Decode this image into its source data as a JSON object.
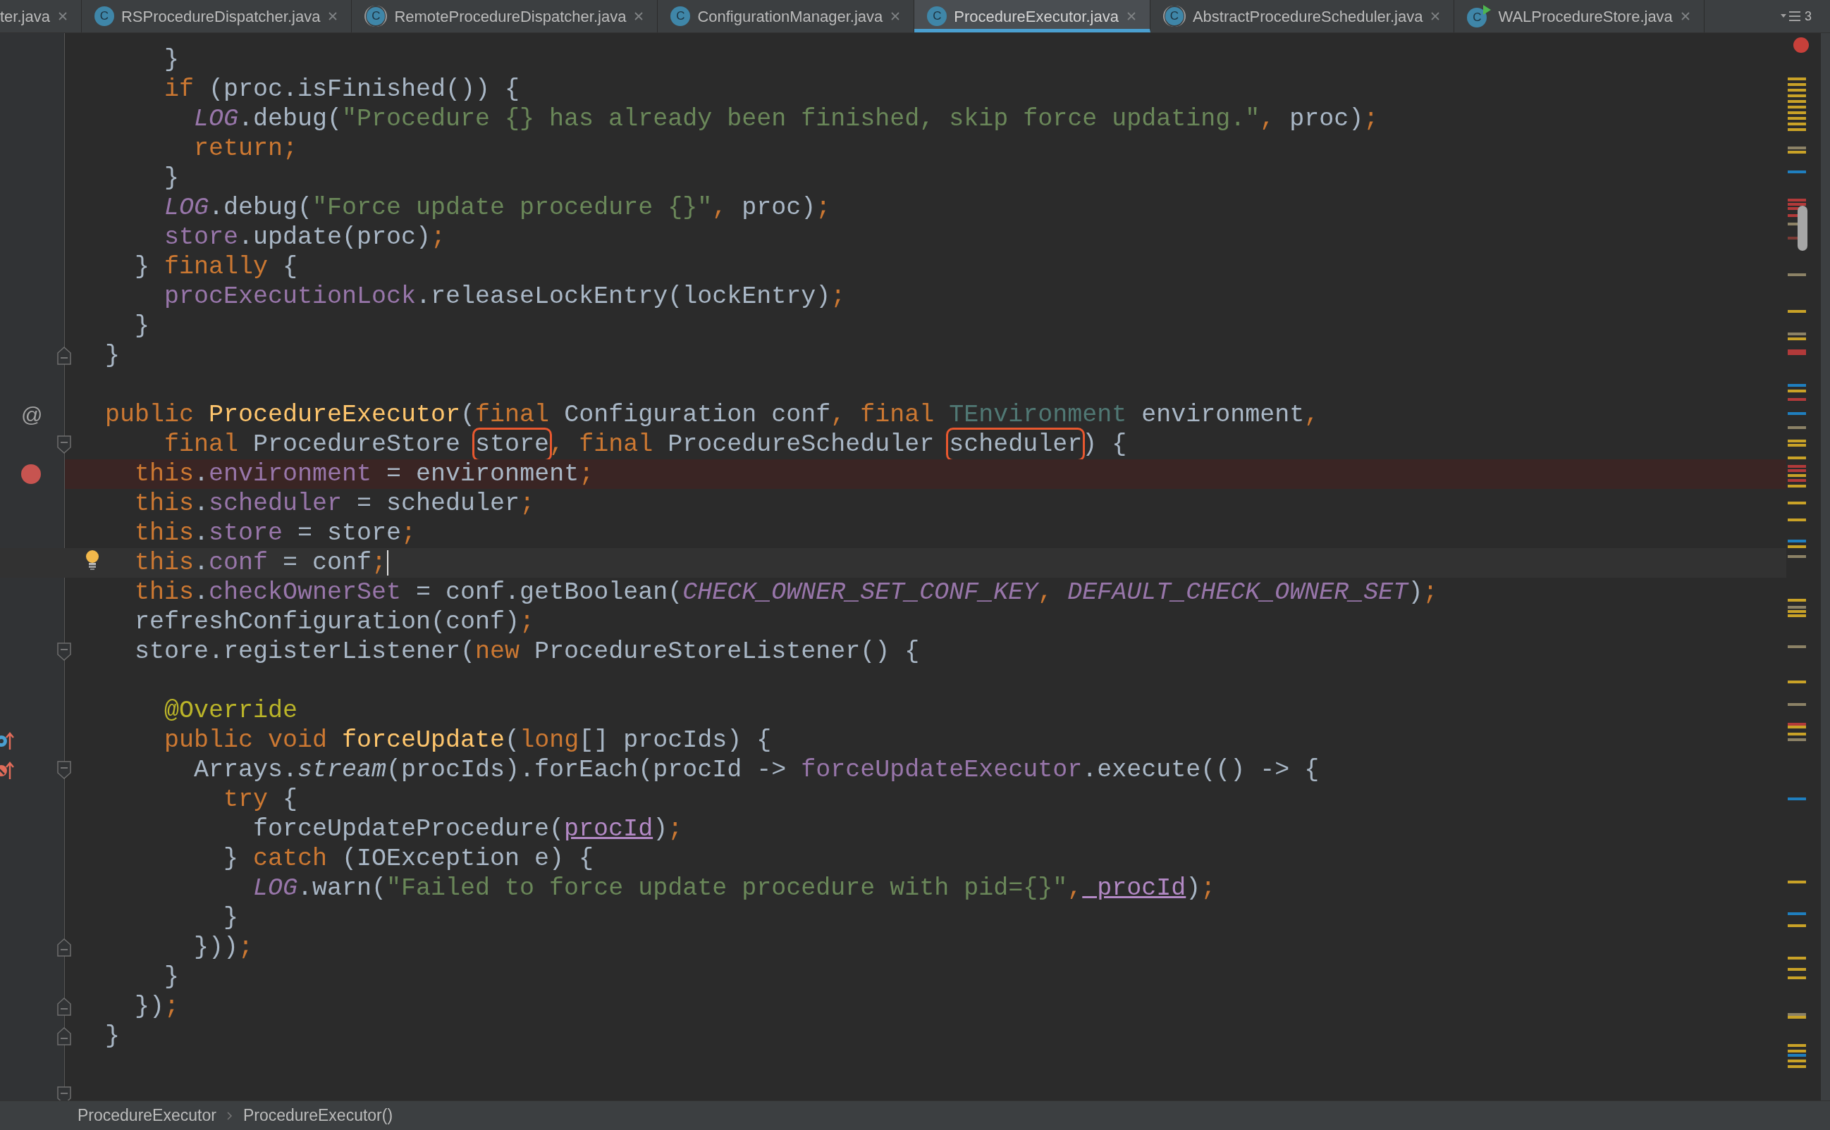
{
  "tabs": [
    {
      "label": "ter.java",
      "selected": false,
      "kind": "file"
    },
    {
      "label": "RSProcedureDispatcher.java",
      "selected": false,
      "kind": "class",
      "icon_letter": "C"
    },
    {
      "label": "RemoteProcedureDispatcher.java",
      "selected": false,
      "kind": "abstract-class",
      "icon_letter": "C"
    },
    {
      "label": "ConfigurationManager.java",
      "selected": false,
      "kind": "class",
      "icon_letter": "C"
    },
    {
      "label": "ProcedureExecutor.java",
      "selected": true,
      "kind": "class",
      "icon_letter": "C"
    },
    {
      "label": "AbstractProcedureScheduler.java",
      "selected": false,
      "kind": "abstract-class",
      "icon_letter": "C"
    },
    {
      "label": "WALProcedureStore.java",
      "selected": false,
      "kind": "runnable-class",
      "icon_letter": "C"
    }
  ],
  "hidden_tab_count": "3",
  "editor": {
    "lines": [
      {
        "breakpoint": false,
        "current": false
      },
      {
        "breakpoint": false,
        "current": false,
        "tokens": [
          {
            "text": "    }",
            "kind": "plain"
          }
        ]
      },
      {
        "breakpoint": false,
        "current": false,
        "tokens": [
          {
            "text": "    if",
            "kind": "keyword"
          },
          {
            "text": " (proc.isFinished()) {",
            "kind": "plain"
          }
        ]
      },
      {
        "breakpoint": false,
        "current": false,
        "tokens": [
          {
            "text": "      LOG",
            "kind": "static-field"
          },
          {
            "text": ".debug(",
            "kind": "plain"
          },
          {
            "text": "\"Procedure {} has already been finished, skip force updating.\"",
            "kind": "string"
          },
          {
            "text": ",",
            "kind": "keyword"
          },
          {
            "text": " proc)",
            "kind": "plain"
          },
          {
            "text": ";",
            "kind": "keyword"
          }
        ]
      },
      {
        "breakpoint": false,
        "current": false,
        "tokens": [
          {
            "text": "      return;",
            "kind": "keyword"
          }
        ]
      },
      {
        "breakpoint": false,
        "current": false,
        "tokens": [
          {
            "text": "    }",
            "kind": "plain"
          }
        ]
      },
      {
        "breakpoint": false,
        "current": false,
        "tokens": [
          {
            "text": "    LOG",
            "kind": "static-field"
          },
          {
            "text": ".debug(",
            "kind": "plain"
          },
          {
            "text": "\"Force update procedure {}\"",
            "kind": "string"
          },
          {
            "text": ",",
            "kind": "keyword"
          },
          {
            "text": " proc)",
            "kind": "plain"
          },
          {
            "text": ";",
            "kind": "keyword"
          }
        ]
      },
      {
        "breakpoint": false,
        "current": false,
        "tokens": [
          {
            "text": "    store",
            "kind": "field"
          },
          {
            "text": ".update(proc)",
            "kind": "plain"
          },
          {
            "text": ";",
            "kind": "keyword"
          }
        ]
      },
      {
        "breakpoint": false,
        "current": false,
        "tokens": [
          {
            "text": "  }",
            "kind": "plain"
          },
          {
            "text": " finally",
            "kind": "keyword"
          },
          {
            "text": " {",
            "kind": "plain"
          }
        ]
      },
      {
        "breakpoint": false,
        "current": false,
        "tokens": [
          {
            "text": "    procExecutionLock",
            "kind": "field"
          },
          {
            "text": ".releaseLockEntry(lockEntry)",
            "kind": "plain"
          },
          {
            "text": ";",
            "kind": "keyword"
          }
        ]
      },
      {
        "breakpoint": false,
        "current": false,
        "tokens": [
          {
            "text": "  }",
            "kind": "plain"
          }
        ]
      },
      {
        "breakpoint": false,
        "current": false,
        "fold": {
          "kind": "end"
        },
        "tokens": [
          {
            "text": "}",
            "kind": "plain"
          }
        ]
      },
      {
        "breakpoint": false,
        "current": false
      },
      {
        "breakpoint": false,
        "current": false,
        "gutter": {
          "kind": "symbol",
          "text": "@"
        },
        "tokens": [
          {
            "text": "public",
            "kind": "keyword"
          },
          {
            "text": " ProcedureExecutor",
            "kind": "method-declaration"
          },
          {
            "text": "(",
            "kind": "plain"
          },
          {
            "text": "final",
            "kind": "keyword"
          },
          {
            "text": " Configuration conf",
            "kind": "plain"
          },
          {
            "text": ",",
            "kind": "keyword"
          },
          {
            "text": " final",
            "kind": "keyword"
          },
          {
            "text": " TEnvironment",
            "kind": "unused-type"
          },
          {
            "text": " environment",
            "kind": "plain"
          },
          {
            "text": ",",
            "kind": "keyword"
          }
        ]
      },
      {
        "breakpoint": false,
        "current": false,
        "fold": {
          "kind": "start"
        },
        "tokens": [
          {
            "text": "    final",
            "kind": "keyword"
          },
          {
            "text": " ProcedureStore ",
            "kind": "plain"
          },
          {
            "text": "store",
            "kind": "highlighted"
          },
          {
            "text": ",",
            "kind": "keyword"
          },
          {
            "text": " final",
            "kind": "keyword"
          },
          {
            "text": " ProcedureScheduler ",
            "kind": "plain"
          },
          {
            "text": "scheduler",
            "kind": "highlighted"
          },
          {
            "text": ") {",
            "kind": "plain"
          }
        ]
      },
      {
        "breakpoint": true,
        "current": false,
        "tokens": [
          {
            "text": "  this",
            "kind": "keyword"
          },
          {
            "text": ".",
            "kind": "plain"
          },
          {
            "text": "environment",
            "kind": "field"
          },
          {
            "text": " = environment",
            "kind": "plain"
          },
          {
            "text": ";",
            "kind": "keyword"
          }
        ]
      },
      {
        "breakpoint": false,
        "current": false,
        "tokens": [
          {
            "text": "  this",
            "kind": "keyword"
          },
          {
            "text": ".",
            "kind": "plain"
          },
          {
            "text": "scheduler",
            "kind": "field"
          },
          {
            "text": " = scheduler",
            "kind": "plain"
          },
          {
            "text": ";",
            "kind": "keyword"
          }
        ]
      },
      {
        "breakpoint": false,
        "current": false,
        "tokens": [
          {
            "text": "  this",
            "kind": "keyword"
          },
          {
            "text": ".",
            "kind": "plain"
          },
          {
            "text": "store",
            "kind": "field"
          },
          {
            "text": " = store",
            "kind": "plain"
          },
          {
            "text": ";",
            "kind": "keyword"
          }
        ]
      },
      {
        "breakpoint": false,
        "current": true,
        "marker": {
          "kind": "bulb"
        },
        "tokens": [
          {
            "text": "  this",
            "kind": "keyword"
          },
          {
            "text": ".",
            "kind": "plain"
          },
          {
            "text": "conf",
            "kind": "field"
          },
          {
            "text": " = conf",
            "kind": "plain"
          },
          {
            "text": ";",
            "kind": "keyword"
          }
        ]
      },
      {
        "breakpoint": false,
        "current": false,
        "tokens": [
          {
            "text": "  this",
            "kind": "keyword"
          },
          {
            "text": ".",
            "kind": "plain"
          },
          {
            "text": "checkOwnerSet",
            "kind": "field"
          },
          {
            "text": " = conf.getBoolean(",
            "kind": "plain"
          },
          {
            "text": "CHECK_OWNER_SET_CONF_KEY",
            "kind": "static-field"
          },
          {
            "text": ",",
            "kind": "keyword"
          },
          {
            "text": " DEFAULT_CHECK_OWNER_SET",
            "kind": "static-field"
          },
          {
            "text": ")",
            "kind": "plain"
          },
          {
            "text": ";",
            "kind": "keyword"
          }
        ]
      },
      {
        "breakpoint": false,
        "current": false,
        "tokens": [
          {
            "text": "  refreshConfiguration(conf)",
            "kind": "plain"
          },
          {
            "text": ";",
            "kind": "keyword"
          }
        ]
      },
      {
        "breakpoint": false,
        "current": false,
        "fold": {
          "kind": "start"
        },
        "tokens": [
          {
            "text": "  store.registerListener(",
            "kind": "plain"
          },
          {
            "text": "new",
            "kind": "keyword"
          },
          {
            "text": " ProcedureStoreListener() {",
            "kind": "plain"
          }
        ]
      },
      {
        "breakpoint": false,
        "current": false
      },
      {
        "breakpoint": false,
        "current": false,
        "tokens": [
          {
            "text": "    @Override",
            "kind": "annotation"
          }
        ]
      },
      {
        "breakpoint": false,
        "current": false,
        "gutter": {
          "kind": "implements"
        },
        "tokens": [
          {
            "text": "    public void",
            "kind": "keyword"
          },
          {
            "text": " forceUpdate",
            "kind": "method-declaration"
          },
          {
            "text": "(",
            "kind": "plain"
          },
          {
            "text": "long",
            "kind": "keyword"
          },
          {
            "text": "[] procIds) {",
            "kind": "plain"
          }
        ]
      },
      {
        "breakpoint": false,
        "current": false,
        "gutter": {
          "kind": "overrides"
        },
        "fold": {
          "kind": "start"
        },
        "tokens": [
          {
            "text": "      Arrays.",
            "kind": "plain"
          },
          {
            "text": "stream",
            "kind": "static-call"
          },
          {
            "text": "(procIds).forEach(procId -> ",
            "kind": "plain"
          },
          {
            "text": "forceUpdateExecutor",
            "kind": "field"
          },
          {
            "text": ".execute(() -> {",
            "kind": "plain"
          }
        ]
      },
      {
        "breakpoint": false,
        "current": false,
        "tokens": [
          {
            "text": "        try",
            "kind": "keyword"
          },
          {
            "text": " {",
            "kind": "plain"
          }
        ]
      },
      {
        "breakpoint": false,
        "current": false,
        "tokens": [
          {
            "text": "          forceUpdateProcedure(",
            "kind": "plain"
          },
          {
            "text": "procId",
            "kind": "captured-variable"
          },
          {
            "text": ")",
            "kind": "plain"
          },
          {
            "text": ";",
            "kind": "keyword"
          }
        ]
      },
      {
        "breakpoint": false,
        "current": false,
        "tokens": [
          {
            "text": "        }",
            "kind": "plain"
          },
          {
            "text": " catch",
            "kind": "keyword"
          },
          {
            "text": " (IOException e) {",
            "kind": "plain"
          }
        ]
      },
      {
        "breakpoint": false,
        "current": false,
        "tokens": [
          {
            "text": "          LOG",
            "kind": "static-field"
          },
          {
            "text": ".warn(",
            "kind": "plain"
          },
          {
            "text": "\"Failed to force update procedure with pid={}\"",
            "kind": "string"
          },
          {
            "text": ",",
            "kind": "keyword"
          },
          {
            "text": " procId",
            "kind": "captured-variable"
          },
          {
            "text": ")",
            "kind": "plain"
          },
          {
            "text": ";",
            "kind": "keyword"
          }
        ]
      },
      {
        "breakpoint": false,
        "current": false,
        "tokens": [
          {
            "text": "        }",
            "kind": "plain"
          }
        ]
      },
      {
        "breakpoint": false,
        "current": false,
        "fold": {
          "kind": "end"
        },
        "tokens": [
          {
            "text": "      }))",
            "kind": "plain"
          },
          {
            "text": ";",
            "kind": "keyword"
          }
        ]
      },
      {
        "breakpoint": false,
        "current": false,
        "tokens": [
          {
            "text": "    }",
            "kind": "plain"
          }
        ]
      },
      {
        "breakpoint": false,
        "current": false,
        "fold": {
          "kind": "end"
        },
        "tokens": [
          {
            "text": "  })",
            "kind": "plain"
          },
          {
            "text": ";",
            "kind": "keyword"
          }
        ]
      },
      {
        "breakpoint": false,
        "current": false,
        "fold": {
          "kind": "end"
        },
        "tokens": [
          {
            "text": "}",
            "kind": "plain"
          }
        ]
      },
      {
        "breakpoint": false,
        "current": false
      },
      {
        "breakpoint": false,
        "current": false,
        "fold": {
          "kind": "start"
        }
      }
    ]
  },
  "breadcrumb": [
    "ProcedureExecutor",
    "ProcedureExecutor()"
  ]
}
